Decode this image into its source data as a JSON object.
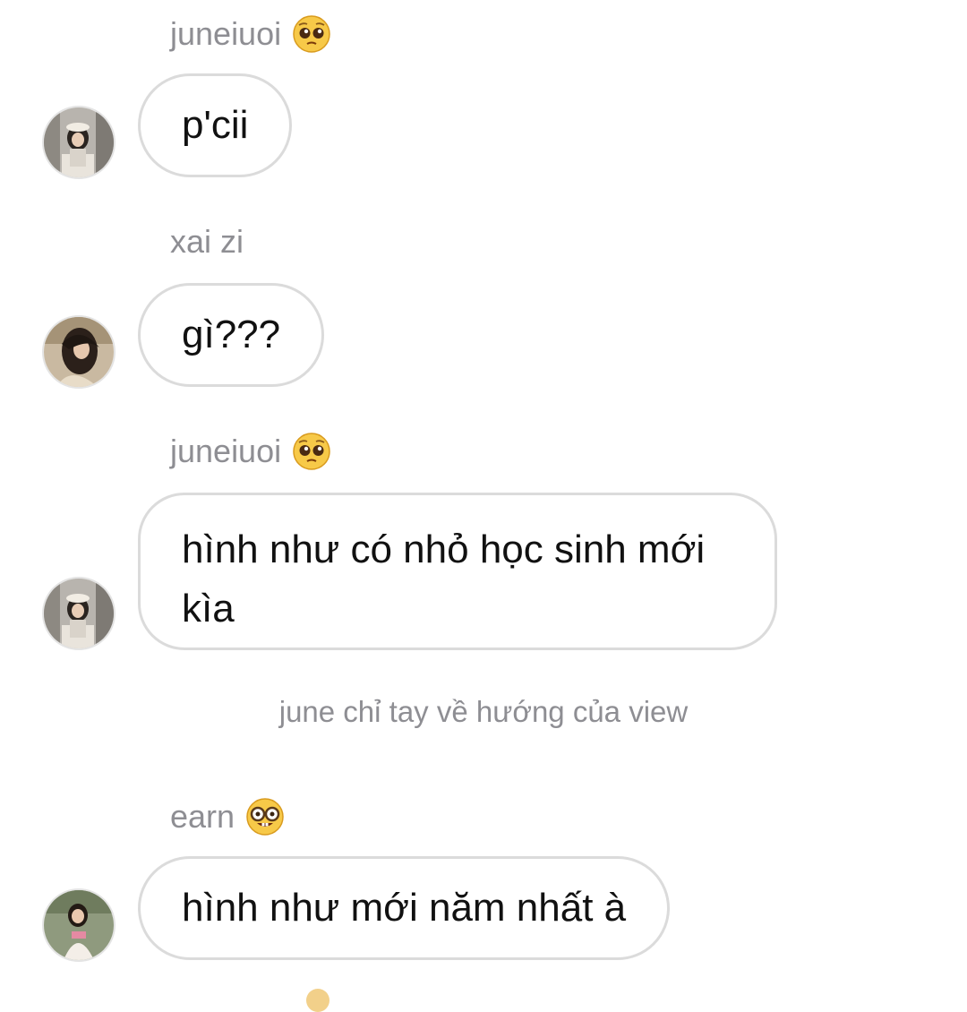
{
  "messages": [
    {
      "sender": "juneiuoi",
      "sender_emoji": "pleading-face-icon",
      "avatar": "avatar-june",
      "text": "p'cii"
    },
    {
      "sender": "xai zi",
      "sender_emoji": "",
      "avatar": "avatar-xai",
      "text": "gì???"
    },
    {
      "sender": "juneiuoi",
      "sender_emoji": "pleading-face-icon",
      "avatar": "avatar-june",
      "text": "hình như có nhỏ học sinh mới kìa"
    },
    {
      "sender": "earn",
      "sender_emoji": "nerd-face-icon",
      "avatar": "avatar-earn",
      "text": "hình như mới năm nhất à"
    }
  ],
  "system_note": "june chỉ tay về hướng của view",
  "colors": {
    "bubble_border": "#dbdbdb",
    "meta_text": "#8e8e93",
    "emoji_yellow": "#f7c948"
  }
}
